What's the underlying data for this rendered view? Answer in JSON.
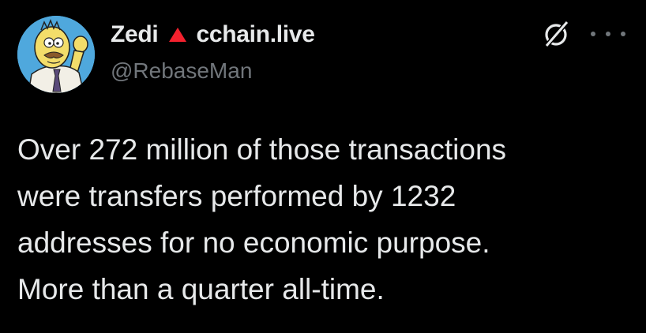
{
  "tweet": {
    "author": {
      "display_name": "Zedi",
      "badge_icon": "red-triangle-icon",
      "name_suffix": "cchain.live",
      "handle": "@RebaseMan",
      "avatar_icon": "cartoon-avatar"
    },
    "actions": {
      "grok_icon": "grok-icon",
      "more_icon": "more-options-icon"
    },
    "body_lines": [
      "Over 272 million of those transactions",
      "were transfers performed by 1232",
      "addresses for no economic purpose.",
      "More than a quarter all-time."
    ]
  },
  "colors": {
    "background": "#000000",
    "text_primary": "#e7e9ea",
    "text_secondary": "#71767b",
    "badge_red": "#f4212e"
  }
}
